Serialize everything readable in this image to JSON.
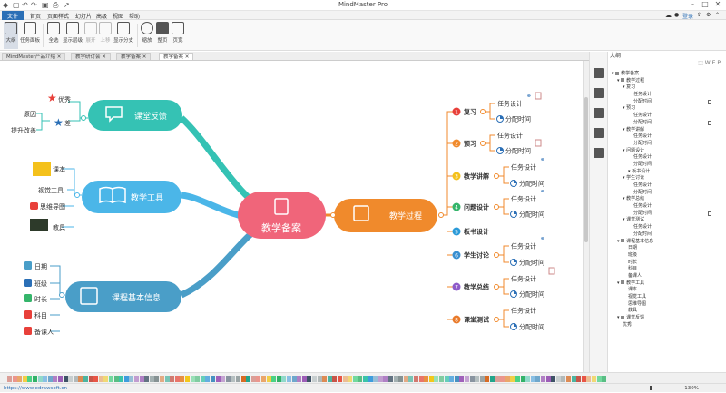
{
  "app": {
    "title": "MindMaster Pro",
    "login_label": "登录"
  },
  "menu": {
    "file": "文件",
    "items": [
      "首页",
      "页面样式",
      "幻灯片",
      "高级",
      "视图",
      "帮助"
    ]
  },
  "ribbon": {
    "buttons": [
      "大纲",
      "任务面板",
      "全选",
      "显示层级",
      "展开",
      "上移",
      "显示分支",
      "缩放",
      "整页",
      "页宽"
    ]
  },
  "tabs": [
    "MindMaster产品介绍",
    "教学研讨会",
    "教学备案",
    "教学备案"
  ],
  "mindmap": {
    "central": "教学备案",
    "branch_feedback": "课堂反馈",
    "branch_tools": "教学工具",
    "branch_info": "课程基本信息",
    "branch_process": "教学过程",
    "feedback_items": [
      "优秀",
      "差"
    ],
    "feedback_sub": [
      "原因",
      "提升改善"
    ],
    "tool_items": [
      "课本",
      "视觉工具",
      "思维导图",
      "教具"
    ],
    "info_items": [
      "日期",
      "班级",
      "时长",
      "科目",
      "备课人"
    ],
    "process_items": [
      {
        "num": "1",
        "label": "复习"
      },
      {
        "num": "2",
        "label": "预习"
      },
      {
        "num": "3",
        "label": "教学讲解"
      },
      {
        "num": "4",
        "label": "问题设计"
      },
      {
        "num": "5",
        "label": "板书设计"
      },
      {
        "num": "6",
        "label": "学生讨论"
      },
      {
        "num": "7",
        "label": "教学总结"
      },
      {
        "num": "8",
        "label": "课堂测试"
      }
    ],
    "task_label": "任务设计",
    "time_label": "分配时间"
  },
  "outline": {
    "title": "大纲",
    "rows": [
      "教学备案",
      "教学过程",
      "复习",
      "任务设计",
      "分配时间",
      "预习",
      "任务设计",
      "分配时间",
      "教学讲解",
      "任务设计",
      "分配时间",
      "问题设计",
      "任务设计",
      "分配时间",
      "板书设计",
      "学生讨论",
      "任务设计",
      "分配时间",
      "教学总结",
      "任务设计",
      "分配时间",
      "课堂测试",
      "任务设计",
      "分配时间",
      "课程基本信息",
      "日期",
      "班级",
      "时长",
      "科目",
      "备课人",
      "教学工具",
      "课本",
      "视觉工具",
      "思维导图",
      "教具",
      "课堂反馈",
      "优秀"
    ]
  },
  "status": {
    "url": "https://www.edrawsoft.cn",
    "zoom": "130%"
  },
  "colors": {
    "central": "#f0657a",
    "feedback": "#35c2b4",
    "tools": "#4bb6e8",
    "info": "#4a9ec8",
    "process": "#f08a2c",
    "number_colors": [
      "#e8403a",
      "#f08a2c",
      "#f4c11b",
      "#35b56b",
      "#2b9ad8",
      "#3a8fd0",
      "#8e5bc9",
      "#e97a2a"
    ]
  }
}
